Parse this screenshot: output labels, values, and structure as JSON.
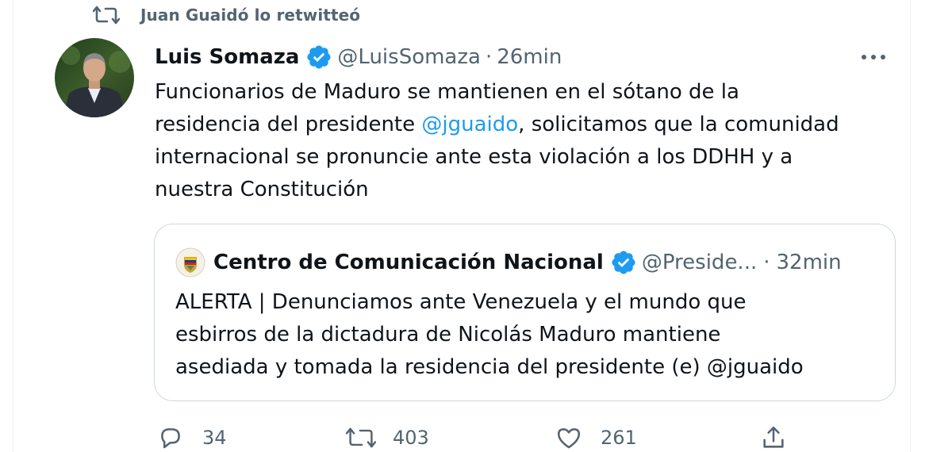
{
  "retweet_banner": {
    "icon": "retweet-icon",
    "text": "Juan Guaidó lo retwitteó"
  },
  "tweet": {
    "author_name": "Luis Somaza",
    "verified_icon": "verified-badge-icon",
    "handle": "@LuisSomaza",
    "separator": "·",
    "time": "26min",
    "more_icon": "more-options-icon",
    "text_lines": [
      {
        "before": "Funcionarios de Maduro se mantienen en el sótano de la",
        "mention": "",
        "after": ""
      },
      {
        "before": "residencia del presidente ",
        "mention": "@jguaido",
        "after": ", solicitamos que la comunidad"
      },
      {
        "before": "internacional se pronuncie ante esta violación a los DDHH y a",
        "mention": "",
        "after": ""
      },
      {
        "before": "nuestra Constitución",
        "mention": "",
        "after": ""
      }
    ]
  },
  "quoted_tweet": {
    "author_name": "Centro de Comunicación Nacional",
    "verified_icon": "verified-badge-icon",
    "handle": "@Preside...",
    "separator": "·",
    "time": "32min",
    "text_lines": [
      "ALERTA | Denunciamos ante Venezuela y el mundo que",
      "esbirros de la dictadura de Nicolás Maduro mantiene",
      "asediada y tomada la residencia del presidente (e) @jguaido"
    ]
  },
  "actions": {
    "reply": {
      "icon": "reply-icon",
      "count": "34"
    },
    "retweet": {
      "icon": "retweet-icon",
      "count": "403"
    },
    "like": {
      "icon": "heart-icon",
      "count": "261"
    },
    "share": {
      "icon": "share-icon",
      "count": ""
    }
  },
  "colors": {
    "link": "#1d9bf0",
    "secondary_text": "#536471",
    "primary_text": "#0f1419",
    "border": "#cfd9de"
  }
}
